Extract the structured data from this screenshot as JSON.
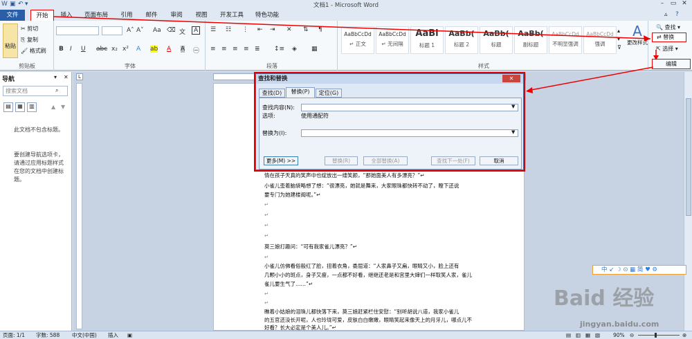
{
  "window": {
    "title": "文档1 - Microsoft Word"
  },
  "tabs": [
    "文件",
    "开始",
    "插入",
    "页面布局",
    "引用",
    "邮件",
    "审阅",
    "视图",
    "开发工具",
    "特色功能"
  ],
  "ribbon": {
    "clipboard": {
      "paste": "粘贴",
      "cut": "剪切",
      "copy": "复制",
      "format_painter": "格式刷",
      "label": "剪贴板"
    },
    "font": {
      "label": "字体"
    },
    "paragraph": {
      "label": "段落"
    },
    "styles": {
      "label": "样式",
      "items": [
        {
          "sample": "AaBbCcDd",
          "name": "↵ 正文"
        },
        {
          "sample": "AaBbCcDd",
          "name": "↵ 无间隔"
        },
        {
          "sample": "AaBl",
          "name": "标题 1"
        },
        {
          "sample": "AaBb(",
          "name": "标题 2"
        },
        {
          "sample": "AaBb(",
          "name": "标题"
        },
        {
          "sample": "AaBb(",
          "name": "副标题"
        },
        {
          "sample": "AaBbCcDd",
          "name": "不明显强调"
        },
        {
          "sample": "AaBbCcDd",
          "name": "强调"
        }
      ],
      "change_styles": "更改样式"
    },
    "editing": {
      "find": "查找",
      "replace": "替换",
      "select": "选择",
      "label": "编辑"
    }
  },
  "nav_pane": {
    "title": "导航",
    "search_placeholder": "搜索文档",
    "msg1": "此文档不包含标题。",
    "msg2": "要创建导航选项卡，请通过应用标题样式在您的文档中创建标题。"
  },
  "dialog": {
    "title": "查找和替换",
    "tabs": [
      "查找(D)",
      "替换(P)",
      "定位(G)"
    ],
    "find_label": "查找内容(N):",
    "options_label": "选项:",
    "options_value": "使用通配符",
    "replace_label": "替换为(I):",
    "btn_more": "更多(M) >>",
    "btn_replace": "替换(R)",
    "btn_replace_all": "全部替换(A)",
    "btn_find_next": "查找下一处(F)",
    "btn_cancel": "取消"
  },
  "document": {
    "lines": [
      "情在孩子天真的笑声中也绽放出一缕笑颜，“那她面美人有多漂亮？”↵",
      "    小雀儿歪着脑袋略想了想：“很漂亮，她就是舞来，大家眼珠都快转不动了，瞪下还说",
      "要专门为她建楼阁呢。”↵",
      "↵",
      "↵",
      "↵",
      "↵",
      "    莫三娘打趣问：“可有我家雀儿漂亮？”↵",
      "↵",
      "    小雀儿仿佛看俗般红了脸，扭着衣角，委屈道：“人家鼻子又扁，眼睛又小，脸上还有",
      "几颗小小的斑点，身子又瘦，一点都不好看，继继还老是和宫里大婶们一样取笑人家，雀儿",
      "雀儿要生气了……”↵",
      "↵",
      "↵",
      "    瞧着小姑娘的泪珠儿都快落下来，莫三娘赶紧栏住安慰：“别听胡说八道，我家小雀儿",
      "的五官还没长开呢，人也玲珑可爱，皮肤白白嫩嫩，眼睛笑起来像天上的月牙儿，哪点儿不",
      "好看？长大必定是个美人儿。”↵"
    ]
  },
  "statusbar": {
    "page": "页面: 1/1",
    "words": "字数: 588",
    "lang": "中文(中国)",
    "insert": "插入",
    "zoom": "90%"
  },
  "baidu": {
    "toolbar": "中 ↙ ☽ ⊙ ▦ 简 ♥ ⚙",
    "watermark": "Baid 经验",
    "url": "jingyan.baidu.com"
  },
  "colors": {
    "accent_red": "#e00000",
    "file_tab": "#2a5ea8"
  }
}
